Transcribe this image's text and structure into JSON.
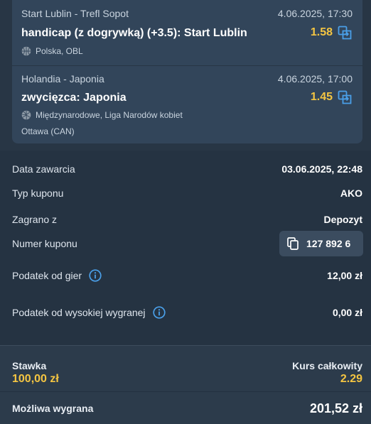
{
  "bets": [
    {
      "match": "Start Lublin - Trefl Sopot",
      "date": "4.06.2025, 17:30",
      "market": "handicap (z dogrywką) (+3.5): Start Lublin",
      "odds": "1.58",
      "league": "Polska, OBL",
      "location": "",
      "icon": "basketball-icon"
    },
    {
      "match": "Holandia - Japonia",
      "date": "4.06.2025, 17:00",
      "market": "zwycięzca: Japonia",
      "odds": "1.45",
      "league": "Międzynarodowe, Liga Narodów kobiet",
      "location": "Ottawa (CAN)",
      "icon": "volleyball-icon"
    }
  ],
  "details": {
    "date_label": "Data zawarcia",
    "date_value": "03.06.2025, 22:48",
    "type_label": "Typ kuponu",
    "type_value": "AKO",
    "played_label": "Zagrano z",
    "played_value": "Depozyt",
    "coupon_label": "Numer kuponu",
    "coupon_value": "127 892 6",
    "tax_label": "Podatek od gier",
    "tax_value": "12,00 zł",
    "high_tax_label": "Podatek od wysokiej wygranej",
    "high_tax_value": "0,00 zł"
  },
  "summary": {
    "stake_label": "Stawka",
    "stake_value": "100,00 zł",
    "total_odds_label": "Kurs całkowity",
    "total_odds_value": "2.29",
    "potential_label": "Możliwa wygrana",
    "potential_value": "201,52 zł"
  },
  "colors": {
    "accent_yellow": "#f4c542",
    "icon_blue": "#4a9fe8",
    "background": "#283645"
  }
}
